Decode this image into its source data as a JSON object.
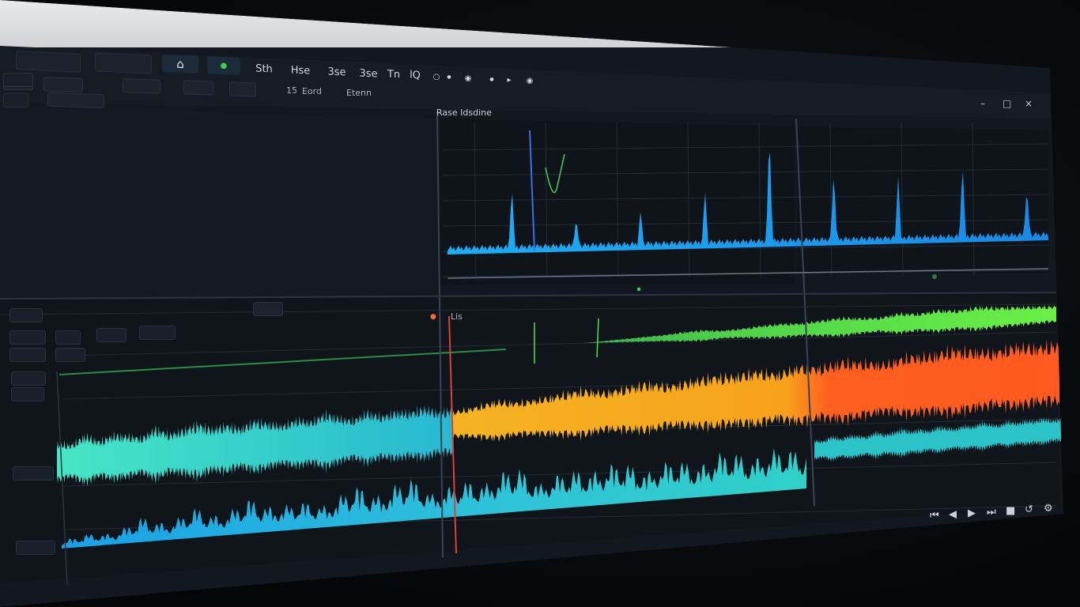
{
  "toolbar": {
    "left_labels": [
      "",
      ""
    ],
    "buttons": [
      "Sth",
      "Hse",
      "3se",
      "3se",
      "Tn",
      "lQ"
    ],
    "icons": [
      "home-icon",
      "dot-icon",
      "circle-icon",
      "dot-icon",
      "circle-icon",
      "dot-icon",
      "dot-icon"
    ],
    "second_row": [
      "",
      "",
      "",
      "",
      "15",
      "Eord",
      "Etenn"
    ]
  },
  "panels": {
    "spectrum_title": "Rase Idsdine",
    "right_panel_title": "",
    "lower_tab": "",
    "lower_marker": "Lis"
  },
  "colors": {
    "background": "#131820",
    "grid": "#2a3340",
    "spectrum": "#1e9bea",
    "green": "#4fe34a",
    "orange": "#f5a623",
    "red_orange": "#ff5a1f",
    "teal": "#33d6c0",
    "blue": "#22a6e8",
    "playhead": "#e0403a"
  },
  "chart_data": {
    "type": "line",
    "series": [
      {
        "values": [
          2,
          2,
          5,
          40,
          3,
          3,
          20,
          3,
          3,
          24,
          3,
          3,
          35,
          4,
          3,
          70,
          4,
          3,
          45,
          3,
          3,
          40,
          3,
          3,
          48,
          3,
          3,
          32,
          2
        ]
      },
      {
        "values": [
          0,
          0,
          0,
          0,
          0,
          1,
          2,
          3,
          4,
          6,
          7,
          5,
          6,
          8,
          9,
          8,
          10,
          12,
          10,
          9,
          13,
          11,
          14,
          12,
          15,
          13,
          12,
          11,
          10
        ]
      },
      {
        "values": [
          9,
          11,
          14,
          12,
          13,
          15,
          17,
          14,
          16,
          18,
          15,
          17,
          19,
          18,
          20,
          17,
          21,
          19,
          22,
          20,
          18,
          22,
          21,
          24,
          22,
          20,
          23,
          21,
          22
        ]
      },
      {
        "values": [
          12,
          10,
          15,
          11,
          14,
          13,
          11,
          16,
          12,
          14,
          17,
          13,
          15,
          12,
          16,
          14,
          12,
          15,
          13,
          17,
          14,
          12,
          16,
          13,
          15,
          14,
          16,
          13,
          14
        ]
      },
      {
        "values": [
          3,
          5,
          4,
          10,
          6,
          12,
          7,
          14,
          9,
          11,
          8,
          16,
          10,
          18,
          9,
          14,
          12,
          19,
          10,
          15,
          13,
          17,
          11,
          16,
          12,
          18,
          13,
          17,
          14
        ]
      }
    ]
  }
}
